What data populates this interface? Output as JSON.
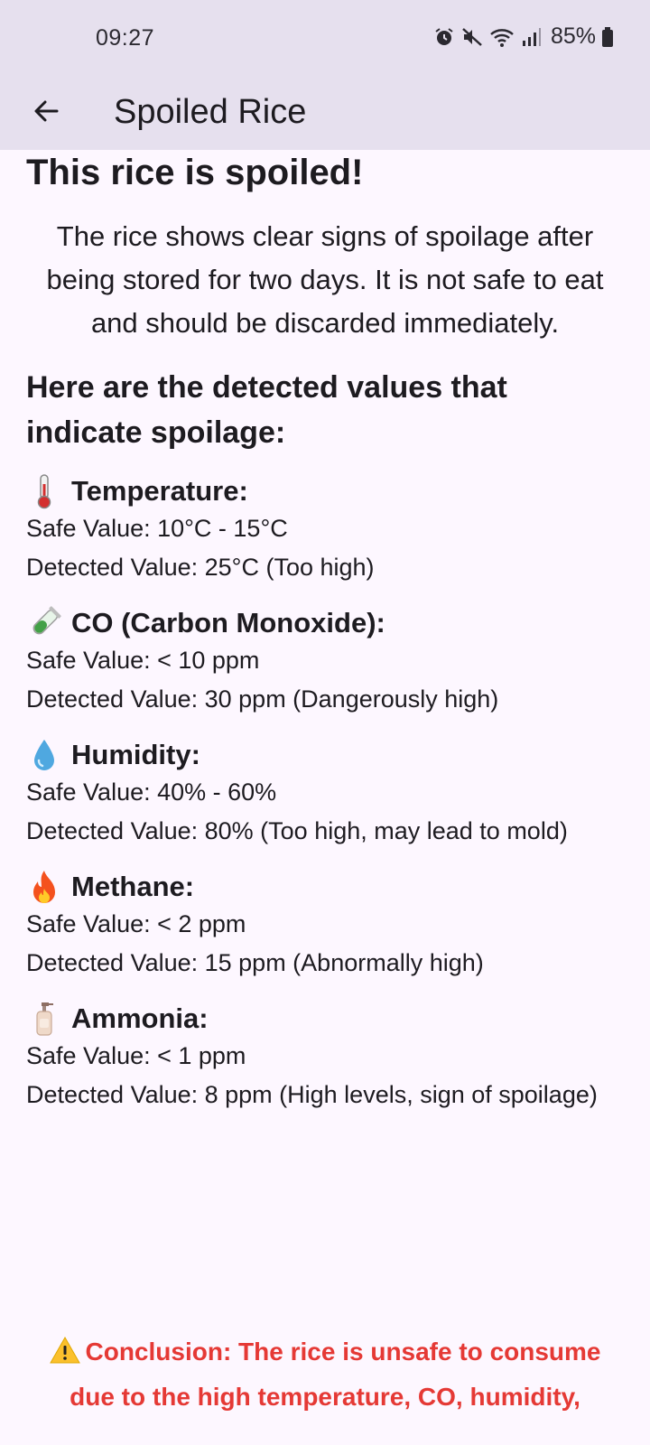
{
  "status": {
    "time": "09:27",
    "battery": "85%"
  },
  "appbar": {
    "title": "Spoiled Rice"
  },
  "content": {
    "headline": "This rice is spoiled!",
    "description": "The rice shows clear signs of spoilage after being stored for two days. It is not safe to eat and should be discarded immediately.",
    "section_heading": "Here are the detected values that indicate spoilage:",
    "metrics": [
      {
        "icon": "thermometer-icon",
        "title": "Temperature:",
        "safe": "Safe Value: 10°C - 15°C",
        "detected": "Detected Value: 25°C (Too high)"
      },
      {
        "icon": "test-tube-icon",
        "title": "CO (Carbon Monoxide):",
        "safe": "Safe Value: < 10 ppm",
        "detected": "Detected Value: 30 ppm (Dangerously high)"
      },
      {
        "icon": "droplet-icon",
        "title": "Humidity:",
        "safe": "Safe Value: 40% - 60%",
        "detected": "Detected Value: 80% (Too high, may lead to mold)"
      },
      {
        "icon": "fire-icon",
        "title": "Methane:",
        "safe": "Safe Value: < 2 ppm",
        "detected": "Detected Value: 15 ppm (Abnormally high)"
      },
      {
        "icon": "lotion-bottle-icon",
        "title": "Ammonia:",
        "safe": "Safe Value: < 1 ppm",
        "detected": "Detected Value: 8 ppm (High levels, sign of spoilage)"
      }
    ],
    "conclusion": "Conclusion: The rice is unsafe to consume due to the high temperature, CO, humidity,"
  },
  "colors": {
    "appbar_bg": "#e6e0ee",
    "page_bg": "#fdf7ff",
    "conclusion": "#e53935"
  }
}
